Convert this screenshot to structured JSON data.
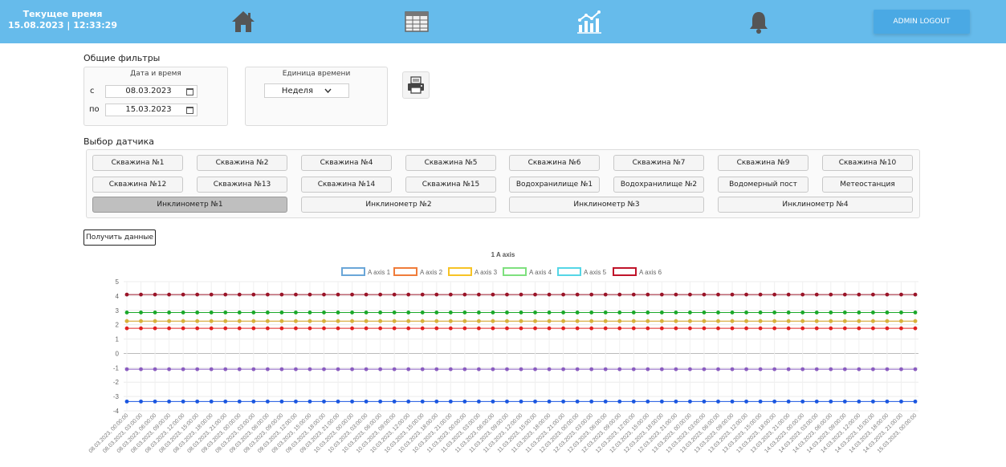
{
  "header": {
    "clock_label": "Текущее время",
    "clock_value": "15.08.2023 | 12:33:29",
    "logout_label": "ADMIN LOGOUT",
    "nav_icons": [
      "home-icon",
      "table-icon",
      "analytics-chart-icon",
      "bell-icon"
    ]
  },
  "filters": {
    "title": "Общие фильтры",
    "date_panel_label": "Дата и время",
    "from_label": "с",
    "from_value": "08.03.2023",
    "to_label": "по",
    "to_value": "15.03.2023",
    "unit_panel_label": "Единица времени",
    "unit_value": "Неделя",
    "print_icon": "printer-icon"
  },
  "sensors": {
    "title": "Выбор датчика",
    "row1": [
      "Скважина №1",
      "Скважина №2",
      "Скважина №4",
      "Скважина №5",
      "Скважина №6",
      "Скважина №7",
      "Скважина №9",
      "Скважина №10"
    ],
    "row2": [
      "Скважина №12",
      "Скважина №13",
      "Скважина №14",
      "Скважина №15",
      "Водохранилище №1",
      "Водохранилище №2",
      "Водомерный пост",
      "Метеостанция"
    ],
    "row3": [
      "Инклинометр №1",
      "Инклинометр №2",
      "Инклинометр №3",
      "Инклинометр №4"
    ],
    "active": "Инклинометр №1"
  },
  "get_data_label": "Получить данные",
  "chart_data": {
    "type": "line",
    "title": "1 A axis",
    "ylim": [
      -4,
      5
    ],
    "yticks": [
      -4,
      -3,
      -2,
      -1,
      0,
      1,
      2,
      3,
      4,
      5
    ],
    "grid": true,
    "legend_position": "top",
    "x_start": "08.03.2023, 00:00:00",
    "x_step_hours": 3,
    "x_count": 57,
    "x_label_every": 1,
    "series": [
      {
        "name": "A axis 1",
        "legend_color": "#6aa6d8",
        "point_color": "#1a56e0",
        "value": -3.35
      },
      {
        "name": "A axis 2",
        "legend_color": "#f07c3a",
        "point_color": "#e8a070",
        "value": 2.25
      },
      {
        "name": "A axis 3",
        "legend_color": "#f7c325",
        "point_color": "#d8b23a",
        "value": 2.25
      },
      {
        "name": "A axis 4",
        "legend_color": "#7ee07e",
        "point_color": "#1aa82a",
        "value": 2.85
      },
      {
        "name": "A axis 5",
        "legend_color": "#55d6e6",
        "point_color": "#8a5cc0",
        "value": -1.1
      },
      {
        "name": "A axis 6",
        "legend_color": "#c0142a",
        "point_color": "#9a1428",
        "value": 4.1
      }
    ],
    "extra_series_colors": {
      "red_dots": "#e02020"
    },
    "extra_values": {
      "red_dots": 1.75
    }
  }
}
